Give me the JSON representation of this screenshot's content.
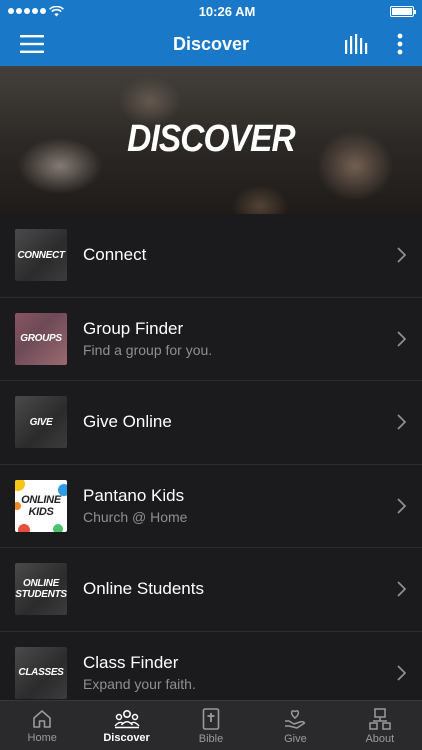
{
  "status_bar": {
    "time": "10:26 AM"
  },
  "app_bar": {
    "title": "Discover"
  },
  "hero": {
    "text": "DISCOVER"
  },
  "list": {
    "items": [
      {
        "label": "Connect",
        "subtitle": "",
        "thumb_text": "Connect"
      },
      {
        "label": "Group Finder",
        "subtitle": "Find a group for you.",
        "thumb_text": "Groups"
      },
      {
        "label": "Give Online",
        "subtitle": "",
        "thumb_text": "Give"
      },
      {
        "label": "Pantano Kids",
        "subtitle": "Church @ Home",
        "thumb_text": "Online Kids"
      },
      {
        "label": "Online Students",
        "subtitle": "",
        "thumb_text": "Online Students"
      },
      {
        "label": "Class Finder",
        "subtitle": "Expand your faith.",
        "thumb_text": "Classes"
      }
    ]
  },
  "tab_bar": {
    "tabs": [
      {
        "label": "Home",
        "icon": "home-icon"
      },
      {
        "label": "Discover",
        "icon": "discover-icon",
        "active": true
      },
      {
        "label": "Bible",
        "icon": "bible-icon"
      },
      {
        "label": "Give",
        "icon": "give-icon"
      },
      {
        "label": "About",
        "icon": "about-icon"
      }
    ]
  },
  "colors": {
    "accent": "#1a78c9",
    "background": "#1b1b1d",
    "tab_bar": "#2a2a2d",
    "subtitle": "#8f8f93"
  }
}
